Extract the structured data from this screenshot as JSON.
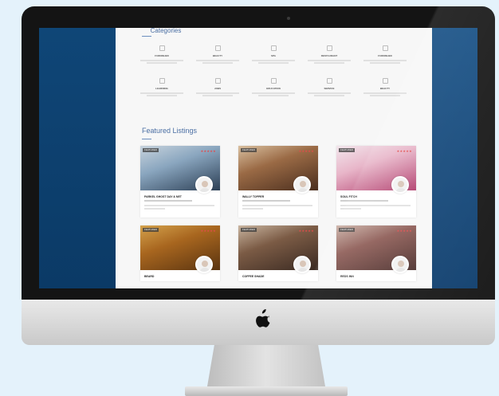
{
  "page": {
    "categories_title": "Categories",
    "featured_title": "Featured Listings"
  },
  "categories": [
    {
      "label": "FURNISHED",
      "icon": "tag-icon"
    },
    {
      "label": "BEAUTY",
      "icon": "mirror-icon"
    },
    {
      "label": "SPA",
      "icon": "spa-icon"
    },
    {
      "label": "RESTAURANT",
      "icon": "fork-icon"
    },
    {
      "label": "FURNISHED",
      "icon": "sofa-icon"
    },
    {
      "label": "LEARNING",
      "icon": "book-icon"
    },
    {
      "label": "JOBS",
      "icon": "pencil-icon"
    },
    {
      "label": "EDUCATION",
      "icon": "cap-icon"
    },
    {
      "label": "SERVICE",
      "icon": "wrench-icon"
    },
    {
      "label": "BEAUTY",
      "icon": "star-icon"
    }
  ],
  "listings": [
    {
      "title": "PARKEL GHOST DAY & NET",
      "tag": "FEATURED",
      "stars": "★★★★★",
      "colors": [
        "#2c3f55",
        "#8aa6bf",
        "#c7d3dd"
      ]
    },
    {
      "title": "WALLY TOPPER",
      "tag": "FEATURED",
      "stars": "★★★★★",
      "colors": [
        "#4a2e1e",
        "#9a6a45",
        "#d9c0a0"
      ]
    },
    {
      "title": "SOUL FITCH",
      "tag": "FEATURED",
      "stars": "★★★★★",
      "colors": [
        "#b03a6a",
        "#e8b6c9",
        "#f2e6ec"
      ]
    },
    {
      "title": "BEARD",
      "tag": "FEATURED",
      "stars": "★★★★★",
      "colors": [
        "#5a3410",
        "#a8661f",
        "#d4a24c"
      ]
    },
    {
      "title": "COFFEE SHADE",
      "tag": "FEATURED",
      "stars": "★★★★★",
      "colors": [
        "#3a2a22",
        "#7b5b45",
        "#c9b5a0"
      ]
    },
    {
      "title": "REDS INN",
      "tag": "FEATURED",
      "stars": "★★★★★",
      "colors": [
        "#4b2f2c",
        "#8c5a54",
        "#cbb1a6"
      ]
    }
  ],
  "brand": {
    "logo": "apple-logo"
  }
}
